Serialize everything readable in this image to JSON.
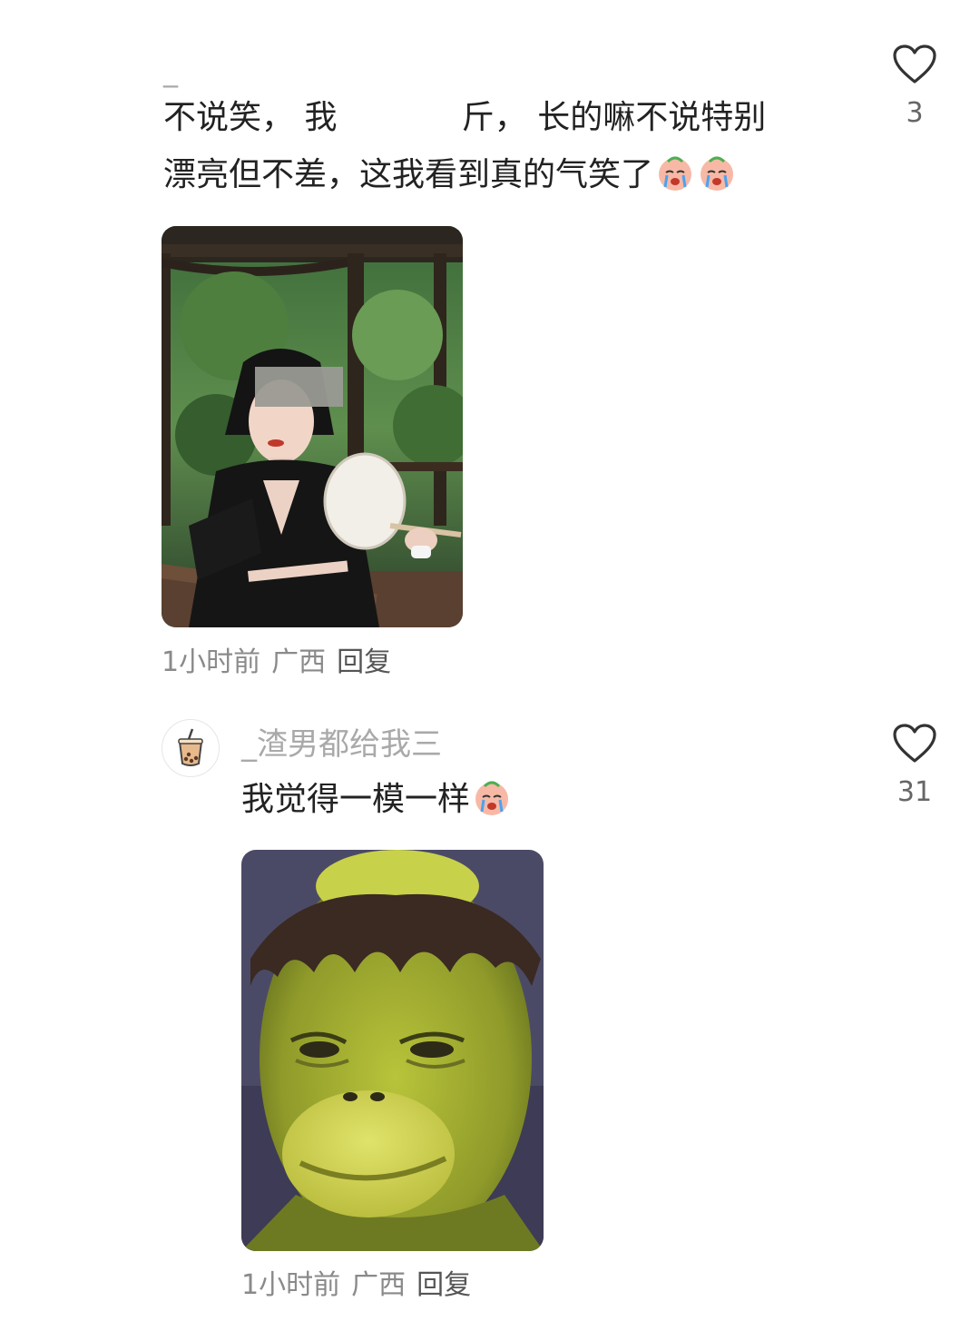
{
  "comments": [
    {
      "username": "_",
      "text_line1": "不说笑， 我            斤， 长的嘛不说特别",
      "text_line2": "漂亮但不差，这我看到真的气笑了",
      "emojis": [
        "crying-face-emoji",
        "crying-face-emoji"
      ],
      "likes": "3",
      "time": "1小时前",
      "location": "广西",
      "reply_label": "回复",
      "image_icon": "photo-woman-with-fan"
    },
    {
      "username": "_渣男都给我三",
      "avatar_icon": "bubble-tea-icon",
      "text": "我觉得一模一样",
      "emojis": [
        "crying-face-emoji"
      ],
      "likes": "31",
      "time": "1小时前",
      "location": "广西",
      "reply_label": "回复",
      "image_icon": "photo-green-alien-face"
    }
  ],
  "icons": {
    "like": "heart-outline-icon"
  },
  "colors": {
    "text": "#222222",
    "muted": "#a9a9a9",
    "meta": "#8a8a8a"
  }
}
